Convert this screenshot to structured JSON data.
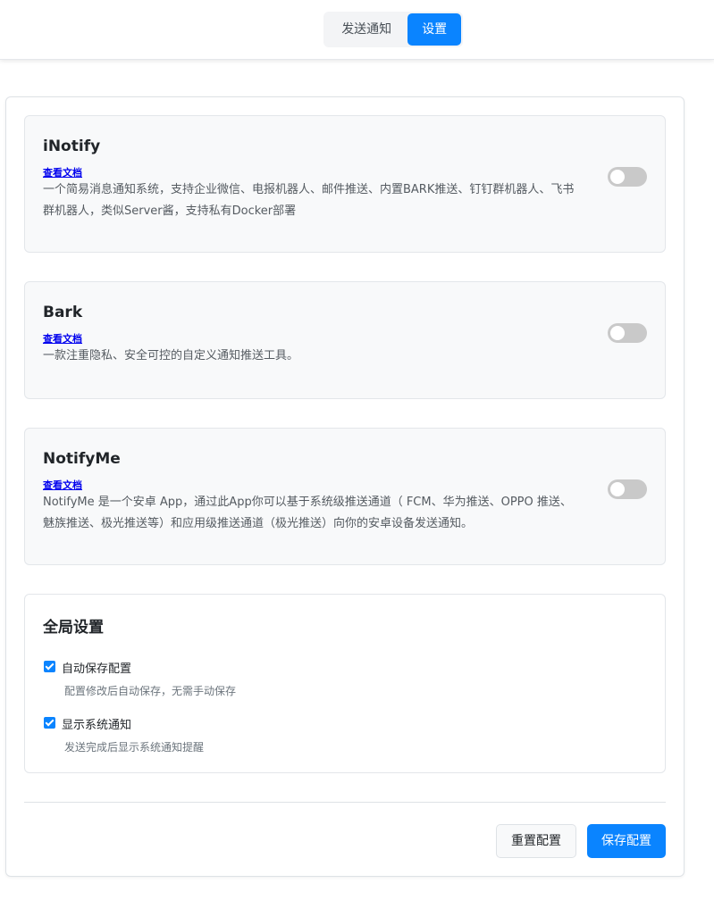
{
  "nav": {
    "tabs": [
      {
        "label": "发送通知"
      },
      {
        "label": "设置"
      }
    ]
  },
  "services": [
    {
      "name": "iNotify",
      "doc_link": "查看文档",
      "description": "一个简易消息通知系统，支持企业微信、电报机器人、邮件推送、内置BARK推送、钉钉群机器人、飞书群机器人，类似Server酱，支持私有Docker部署",
      "enabled": false
    },
    {
      "name": "Bark",
      "doc_link": "查看文档",
      "description": "一款注重隐私、安全可控的自定义通知推送工具。",
      "enabled": false
    },
    {
      "name": "NotifyMe",
      "doc_link": "查看文档",
      "description": "NotifyMe 是一个安卓 App，通过此App你可以基于系统级推送通道（ FCM、华为推送、OPPO 推送、魅族推送、极光推送等）和应用级推送通道（极光推送）向你的安卓设备发送通知。",
      "enabled": false
    }
  ],
  "global": {
    "title": "全局设置",
    "options": [
      {
        "label": "自动保存配置",
        "hint": "配置修改后自动保存，无需手动保存",
        "checked": true
      },
      {
        "label": "显示系统通知",
        "hint": "发送完成后显示系统通知提醒",
        "checked": true
      }
    ]
  },
  "actions": {
    "reset_label": "重置配置",
    "save_label": "保存配置"
  },
  "colors": {
    "accent": "#0a84ff",
    "toggle_off": "#c9c9c9"
  }
}
